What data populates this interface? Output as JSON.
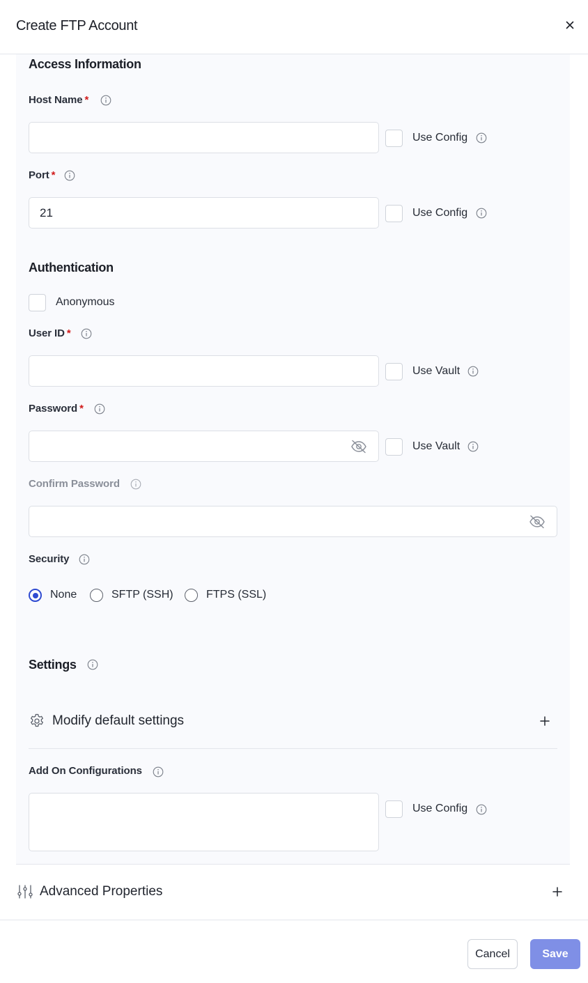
{
  "dialog": {
    "title": "Create FTP Account",
    "close_icon": "close-icon"
  },
  "access": {
    "title": "Access Information",
    "host": {
      "label": "Host Name",
      "required": "*",
      "value": "",
      "use_label": "Use Config"
    },
    "port": {
      "label": "Port",
      "required": "*",
      "value": "21",
      "use_label": "Use Config"
    }
  },
  "auth": {
    "title": "Authentication",
    "anonymous_label": "Anonymous",
    "user": {
      "label": "User ID",
      "required": "*",
      "value": "",
      "use_label": "Use Vault"
    },
    "password": {
      "label": "Password",
      "required": "*",
      "value": "",
      "use_label": "Use Vault"
    },
    "confirm": {
      "label": "Confirm Password",
      "value": ""
    }
  },
  "security": {
    "label": "Security",
    "options": [
      "None",
      "SFTP (SSH)",
      "FTPS (SSL)"
    ],
    "selected": "None"
  },
  "settings": {
    "title": "Settings",
    "modify_label": "Modify default settings",
    "addon": {
      "label": "Add On Configurations",
      "value": "",
      "use_label": "Use Config"
    }
  },
  "advanced": {
    "label": "Advanced Properties"
  },
  "footer": {
    "cancel_label": "Cancel",
    "save_label": "Save"
  },
  "colors": {
    "accent": "#2f4bd1",
    "save_button": "#7f8fe6",
    "required": "#d11b1b",
    "panel_bg": "#f9fafd"
  }
}
